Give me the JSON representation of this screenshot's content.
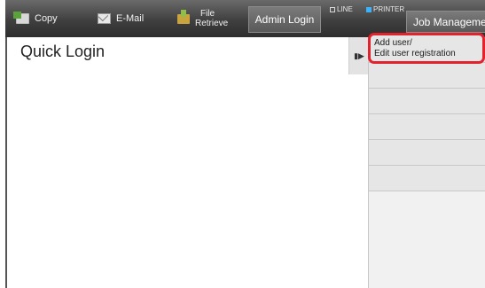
{
  "nav": {
    "copy": "Copy",
    "email": "E-Mail",
    "file_retrieve_1": "File",
    "file_retrieve_2": "Retrieve"
  },
  "admin_login": "Admin Login",
  "status": {
    "line": "LINE",
    "printer": "PRINTER"
  },
  "job_management": "Job Management",
  "page_title": "Quick Login",
  "menu": {
    "item1_line1": "Add user/",
    "item1_line2": "Edit user registration"
  }
}
